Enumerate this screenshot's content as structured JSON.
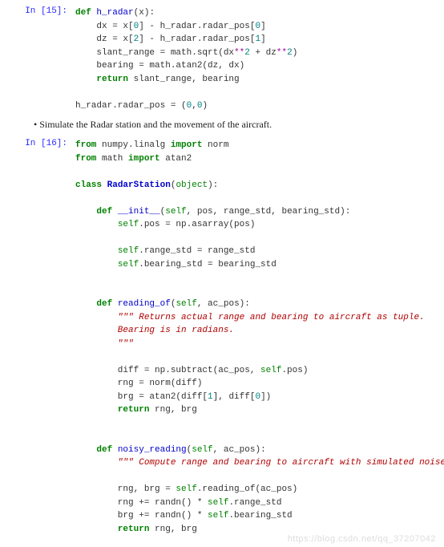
{
  "cell15": {
    "prompt": "In [15]:",
    "l1a": "def",
    "l1b": "h_radar",
    "l1c": "(x):",
    "l2": "    dx = x[",
    "l2n0": "0",
    "l2r": "] - h_radar.radar_pos[",
    "l2n1": "0",
    "l2e": "]",
    "l3": "    dz = x[",
    "l3n0": "2",
    "l3r": "] - h_radar.radar_pos[",
    "l3n1": "1",
    "l3e": "]",
    "l4a": "    slant_range = math.sqrt(dx",
    "l4op": "**",
    "l4n": "2",
    "l4m": " + dz",
    "l4op2": "**",
    "l4n2": "2",
    "l4e": ")",
    "l5": "    bearing = math.atan2(dz, dx)",
    "l6a": "    ",
    "l6r": "return",
    "l6b": " slant_range, bearing",
    "l8a": "h_radar.radar_pos = (",
    "l8n0": "0",
    "l8c": ",",
    "l8n1": "0",
    "l8e": ")"
  },
  "prose": "Simulate the Radar station and the movement of the aircraft.",
  "cell16": {
    "prompt": "In [16]:",
    "l1a": "from",
    "l1b": " numpy.linalg ",
    "l1c": "import",
    "l1d": " norm",
    "l2a": "from",
    "l2b": " math ",
    "l2c": "import",
    "l2d": " atan2",
    "l4a": "class",
    "l4b": " ",
    "l4c": "RadarStation",
    "l4d": "(",
    "l4e": "object",
    "l4f": "):",
    "l6a": "    ",
    "l6d": "def",
    "l6f": " __init__",
    "l6p": "(",
    "l6s": "self",
    "l6r": ", pos, range_std, bearing_std):",
    "l7a": "        ",
    "l7s": "self",
    "l7b": ".pos = np.asarray(pos)",
    "l9a": "        ",
    "l9s": "self",
    "l9b": ".range_std = range_std",
    "l10a": "        ",
    "l10s": "self",
    "l10b": ".bearing_std = bearing_std",
    "l13a": "    ",
    "l13d": "def",
    "l13f": " reading_of",
    "l13p": "(",
    "l13s": "self",
    "l13r": ", ac_pos):",
    "l14a": "        ",
    "l14b": "\"\"\" Returns actual range and bearing to aircraft as tuple.",
    "l15": "        Bearing is in radians.",
    "l16": "        \"\"\"",
    "l18a": "        diff = np.subtract(ac_pos, ",
    "l18s": "self",
    "l18b": ".pos)",
    "l19": "        rng = norm(diff)",
    "l20a": "        brg = atan2(diff[",
    "l20n0": "1",
    "l20b": "], diff[",
    "l20n1": "0",
    "l20c": "])",
    "l21a": "        ",
    "l21r": "return",
    "l21b": " rng, brg",
    "l24a": "    ",
    "l24d": "def",
    "l24f": " noisy_reading",
    "l24p": "(",
    "l24s": "self",
    "l24r": ", ac_pos):",
    "l25a": "        ",
    "l25b": "\"\"\" Compute range and bearing to aircraft with simulated noise\"\"\"",
    "l27a": "        rng, brg = ",
    "l27s": "self",
    "l27b": ".reading_of(ac_pos)",
    "l28a": "        rng += randn() * ",
    "l28s": "self",
    "l28b": ".range_std",
    "l29a": "        brg += randn() * ",
    "l29s": "self",
    "l29b": ".bearing_std",
    "l30a": "        ",
    "l30r": "return",
    "l30b": " rng, brg"
  },
  "watermark": "https://blog.csdn.net/qq_37207042"
}
